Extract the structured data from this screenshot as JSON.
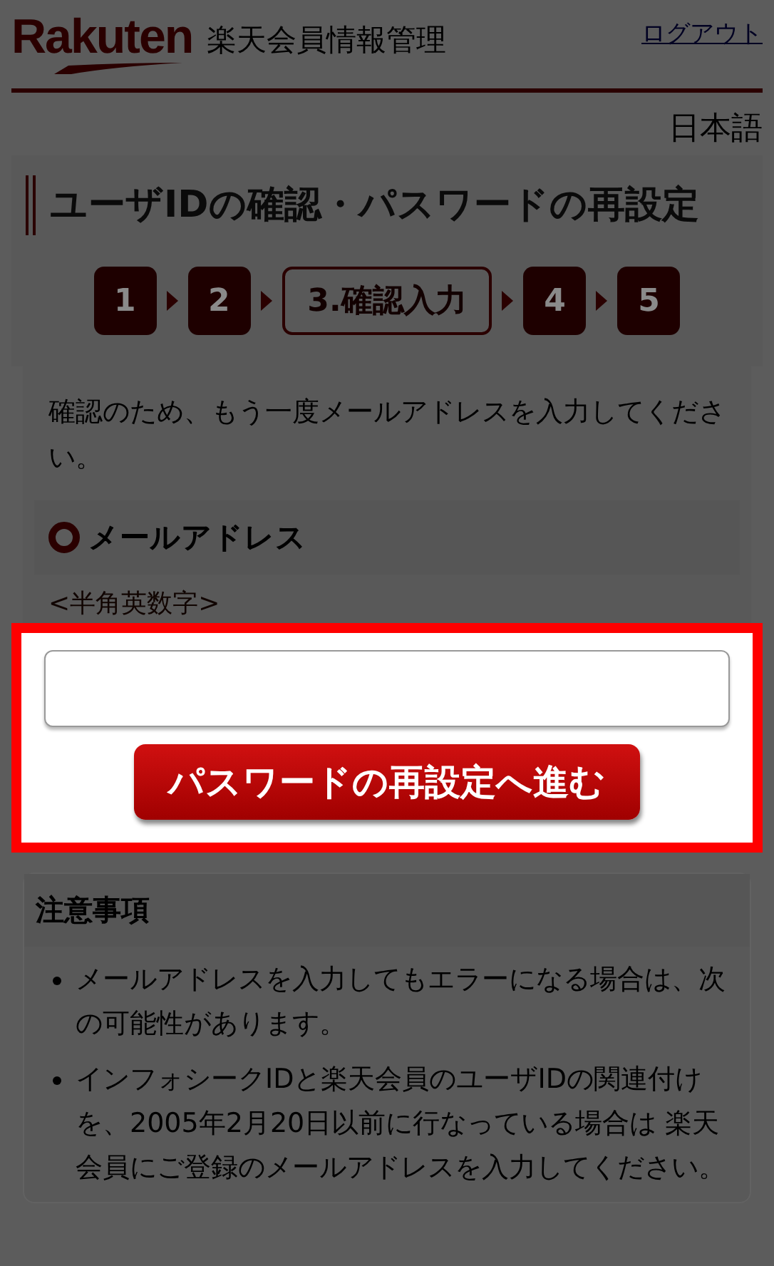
{
  "header": {
    "logo": "Rakuten",
    "site_title": "楽天会員情報管理",
    "logout_link": "ログアウト"
  },
  "language": "日本語",
  "page_title": "ユーザIDの確認・パスワードの再設定",
  "steps": [
    {
      "label": "1",
      "selected": false
    },
    {
      "label": "2",
      "selected": false
    },
    {
      "label": "3.確認入力",
      "selected": true
    },
    {
      "label": "4",
      "selected": false
    },
    {
      "label": "5",
      "selected": false
    }
  ],
  "instruction": "確認のため、もう一度メールアドレスを入力してください。",
  "field": {
    "label": "メールアドレス",
    "hint": "<半角英数字>"
  },
  "submit_button": "パスワードの再設定へ進む",
  "notice": {
    "title": "注意事項",
    "items": [
      "メールアドレスを入力してもエラーになる場合は、次の可能性があります。",
      "インフォシークIDと楽天会員のユーザIDの関連付けを、2005年2月20日以前に行なっている場合は 楽天会員にご登録のメールアドレスを入力してください。"
    ]
  }
}
